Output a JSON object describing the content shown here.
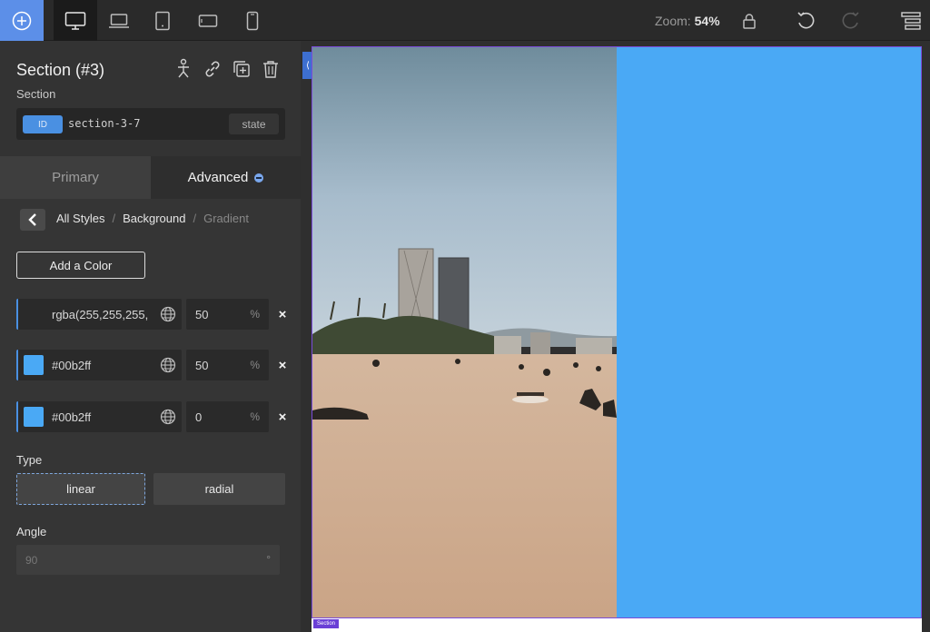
{
  "toolbar": {
    "add_icon": "plus-circle-icon",
    "devices": [
      {
        "name": "desktop",
        "icon": "monitor-icon",
        "active": true
      },
      {
        "name": "laptop",
        "icon": "laptop-icon",
        "active": false
      },
      {
        "name": "tablet",
        "icon": "tablet-icon",
        "active": false
      },
      {
        "name": "tablet-landscape",
        "icon": "tablet-landscape-icon",
        "active": false
      },
      {
        "name": "phone",
        "icon": "phone-icon",
        "active": false
      }
    ],
    "zoom_label": "Zoom:",
    "zoom_value": "54%"
  },
  "panel": {
    "title": "Section (#3)",
    "subtitle": "Section",
    "id_badge": "ID",
    "id_value": "section-3-7",
    "state_label": "state",
    "tabs": {
      "primary": "Primary",
      "advanced": "Advanced"
    },
    "breadcrumb": {
      "item1": "All Styles",
      "sep": "/",
      "item2": "Background",
      "item3": "Gradient"
    },
    "add_color_label": "Add a Color",
    "colors": [
      {
        "value": "rgba(255,255,255,",
        "percent": "50",
        "unit": "%",
        "has_swatch": false
      },
      {
        "value": "#00b2ff",
        "percent": "50",
        "unit": "%",
        "has_swatch": true
      },
      {
        "value": "#00b2ff",
        "percent": "0",
        "unit": "%",
        "has_swatch": true
      }
    ],
    "remove_label": "×",
    "type_label": "Type",
    "type_linear": "linear",
    "type_radial": "radial",
    "angle_label": "Angle",
    "angle_placeholder": "90",
    "angle_unit": "°"
  },
  "canvas": {
    "handle_label": "⟨",
    "section_tag": "Section"
  },
  "colors": {
    "accent": "#4a90e2",
    "add_button_bg": "#5c8fe8",
    "overlay_blue": "#4aa9f5",
    "frame_outline": "#7a4cd9"
  }
}
